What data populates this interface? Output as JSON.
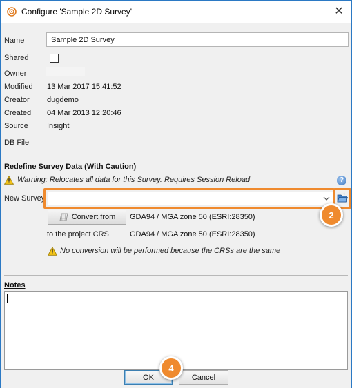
{
  "window": {
    "title": "Configure 'Sample 2D Survey'",
    "close_symbol": "✕"
  },
  "fields": {
    "name_label": "Name",
    "name_value": "Sample 2D Survey",
    "shared_label": "Shared",
    "shared_checked": false,
    "owner_label": "Owner",
    "owner_value": "",
    "modified_label": "Modified",
    "modified_value": "13 Mar 2017 15:41:52",
    "creator_label": "Creator",
    "creator_value": "dugdemo",
    "created_label": "Created",
    "created_value": "04 Mar 2013 12:20:46",
    "source_label": "Source",
    "source_value": "Insight",
    "dbfile_label": "DB File",
    "dbfile_value": ""
  },
  "redefine": {
    "heading": "Redefine Survey Data (With Caution)",
    "warning": "Warning: Relocates all data for this Survey. Requires Session Reload",
    "new_survey_label": "New Survey",
    "new_survey_value": "",
    "convert_from_button": "Convert from",
    "convert_from_crs": "GDA94 / MGA zone 50 (ESRI:28350)",
    "to_project_label": "to the project CRS",
    "project_crs": "GDA94 / MGA zone 50 (ESRI:28350)",
    "no_conversion_note": "No conversion will be performed because the CRSs are the same"
  },
  "notes": {
    "heading": "Notes",
    "value": ""
  },
  "buttons": {
    "ok": "OK",
    "cancel": "Cancel"
  },
  "callouts": {
    "step_browse": "2",
    "step_ok": "4"
  },
  "colors": {
    "highlight": "#ef8a2e",
    "window_border": "#2b79c4",
    "warning_yellow": "#f5c518"
  },
  "icons": {
    "app": "survey-target-icon",
    "close": "close-icon",
    "warning": "warning-triangle-icon",
    "help": "help-icon",
    "browse": "open-folder-icon",
    "convert": "grid-icon",
    "dropdown": "chevron-down-icon"
  }
}
